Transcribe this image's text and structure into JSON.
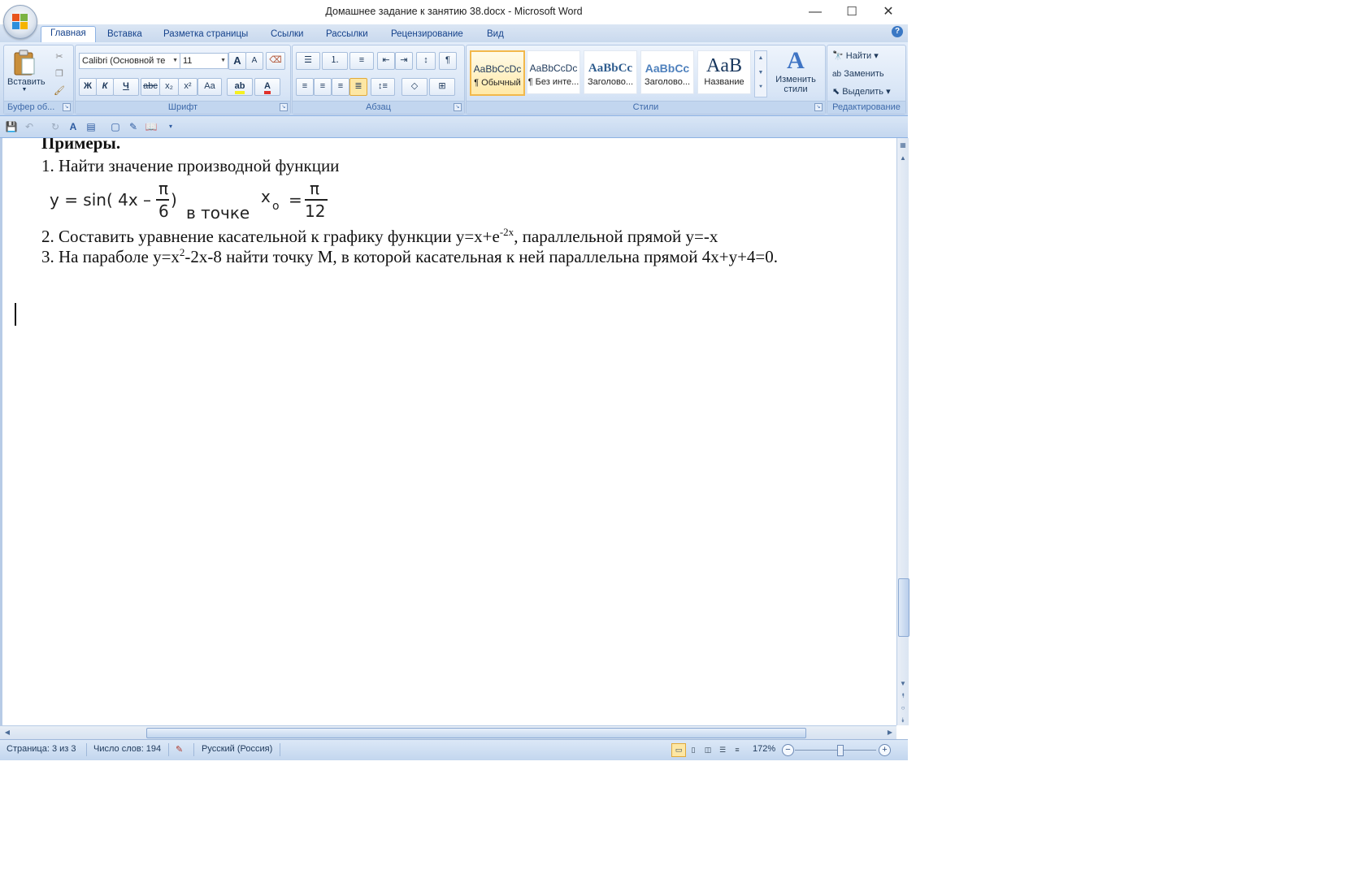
{
  "window": {
    "title": "Домашнее задание к занятию 38.docx - Microsoft Word",
    "controls": {
      "minimize": "—",
      "maximize": "☐",
      "close": "✕"
    }
  },
  "ribbon_tabs": [
    "Главная",
    "Вставка",
    "Разметка страницы",
    "Ссылки",
    "Рассылки",
    "Рецензирование",
    "Вид"
  ],
  "clipboard": {
    "paste_label": "Вставить",
    "group_label": "Буфер об..."
  },
  "font": {
    "name": "Calibri (Основной те",
    "size": "11",
    "group_label": "Шрифт",
    "bold": "Ж",
    "italic": "К",
    "underline": "Ч",
    "strike": "abc",
    "subscript": "x₂",
    "superscript": "x²",
    "case": "Aa",
    "grow": "A",
    "shrink": "A",
    "font_color": "#e0302a",
    "highlight_color": "#f5f022"
  },
  "paragraph": {
    "group_label": "Абзац",
    "pilcrow": "¶"
  },
  "styles": {
    "group_label": "Стили",
    "items": [
      {
        "sample": "AaBbCcDc",
        "name": "¶ Обычный"
      },
      {
        "sample": "AaBbCcDc",
        "name": "¶ Без инте..."
      },
      {
        "sample": "AaBbCc",
        "name": "Заголово..."
      },
      {
        "sample": "AaBbCc",
        "name": "Заголово..."
      },
      {
        "sample": "AaB",
        "name": "Название"
      }
    ],
    "change_styles": "Изменить стили"
  },
  "editing": {
    "group_label": "Редактирование",
    "find": "Найти",
    "replace": "Заменить",
    "select": "Выделить"
  },
  "document": {
    "heading": "Примеры.",
    "item1": "1. Найти значение производной функции",
    "formula": {
      "lhs": "y = sin( 4x –",
      "num1": "π",
      "den1": "6",
      "close": ")",
      "mid": "в точке",
      "var": "x",
      "sub": "o",
      "eq": "=",
      "num2": "π",
      "den2": "12"
    },
    "item2_a": "2. Составить уравнение касательной к графику функции y=x+e",
    "item2_sup": "-2x",
    "item2_b": ", параллельной прямой y=-x",
    "item3_a": "3. На параболе y=x",
    "item3_sup": "2",
    "item3_b": "-2x-8 найти точку М, в которой касательная к ней параллельна прямой 4x+y+4=0."
  },
  "status": {
    "page": "Страница: 3 из 3",
    "words": "Число слов: 194",
    "language": "Русский (Россия)",
    "zoom": "172%",
    "zoom_percent": 172
  }
}
